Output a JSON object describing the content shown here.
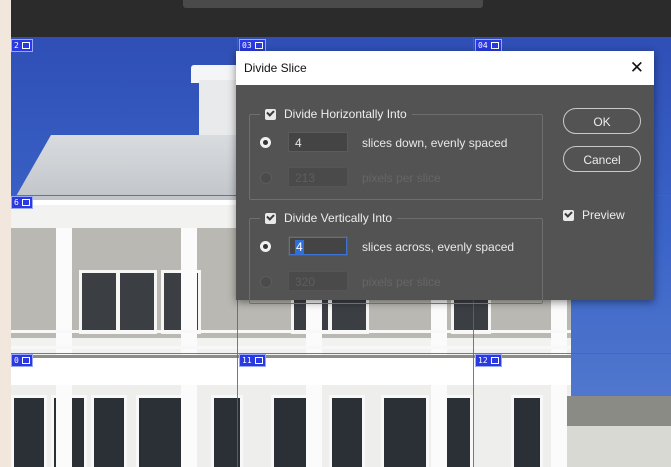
{
  "slice_badges": {
    "b02": "2",
    "b03": "03",
    "b04": "04",
    "b06": "6",
    "b10": "0",
    "b11": "11",
    "b12": "12"
  },
  "dialog": {
    "title": "Divide Slice",
    "close_symbol": "✕",
    "horizontal": {
      "checkbox_label": "Divide Horizontally Into",
      "slices_value": "4",
      "slices_text": "slices down, evenly spaced",
      "pixels_value": "213",
      "pixels_text": "pixels per slice"
    },
    "vertical": {
      "checkbox_label": "Divide Vertically Into",
      "slices_value": "4",
      "slices_text": "slices across, evenly spaced",
      "pixels_value": "320",
      "pixels_text": "pixels per slice"
    },
    "ok_label": "OK",
    "cancel_label": "Cancel",
    "preview_label": "Preview"
  },
  "colors": {
    "dialog_bg": "#535353",
    "slice_guide": "#3c5aff",
    "sky": "#2f4fb6"
  }
}
